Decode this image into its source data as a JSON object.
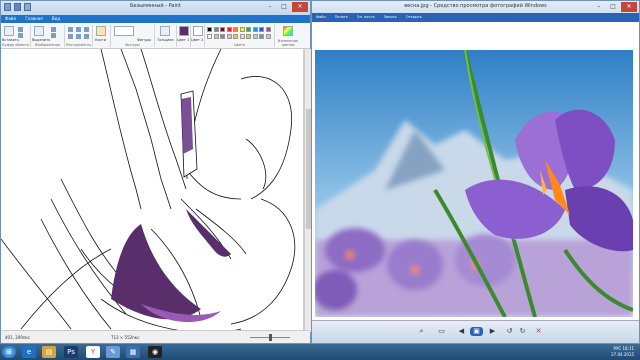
{
  "paint": {
    "title": "Безымянный - Paint",
    "menu": [
      "Файл",
      "Главная",
      "Вид"
    ],
    "groups": [
      "Буфер обмена",
      "Изображение",
      "Инструменты",
      "Кисти",
      "Фигуры",
      "Толщина",
      "Цвет 1",
      "Цвет 2",
      "Цвета",
      "Изменение цветов"
    ],
    "labels": {
      "paste": "Вставить",
      "select": "Выделить",
      "brush": "Кисти",
      "shapes": "Фигуры",
      "size": "Толщина",
      "color1": "Цвет 1",
      "color2": "Цвет 2"
    },
    "status": {
      "pos": "401, 309пкс",
      "size": "712 × 552пкс"
    },
    "palette": [
      "#000000",
      "#7f7f7f",
      "#880015",
      "#ed1c24",
      "#ff7f27",
      "#fff200",
      "#22b14c",
      "#00a2e8",
      "#3f48cc",
      "#a349a4",
      "#ffffff",
      "#c3c3c3",
      "#b97a57",
      "#ffaec9",
      "#ffc90e",
      "#efe4b0",
      "#b5e61d",
      "#99d9ea",
      "#7092be",
      "#c8bfe7"
    ],
    "fill_dark": "#5a2e6a",
    "fill_light": "#9b59b6"
  },
  "viewer": {
    "title": "весна.jpg - Средство просмотра фотографий Windows",
    "toolbar": [
      "Файл",
      "Печать",
      "Эл. почта",
      "Запись",
      "Открыть"
    ]
  },
  "taskbar": {
    "time": "18:11",
    "date": "27.04.2015",
    "lang": "РУС"
  }
}
